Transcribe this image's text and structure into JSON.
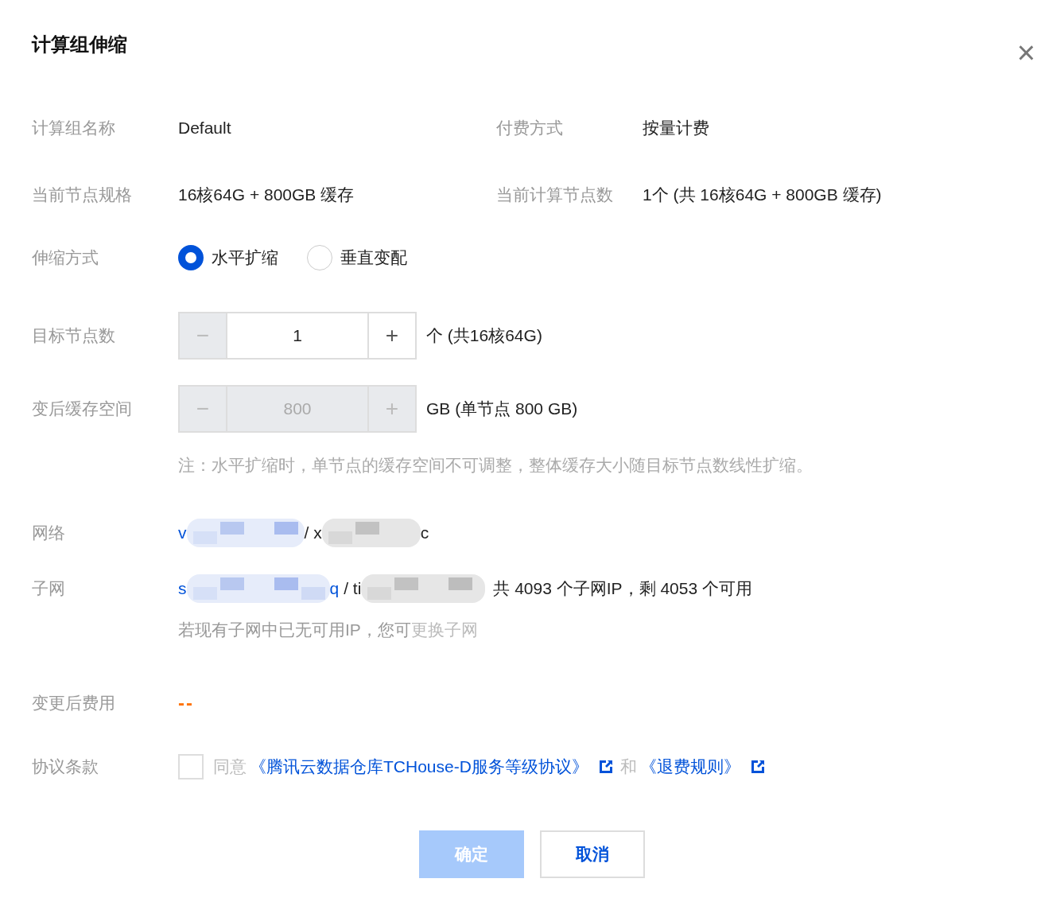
{
  "dialog": {
    "title": "计算组伸缩",
    "close": "×"
  },
  "info": [
    {
      "label": "计算组名称",
      "value": "Default",
      "label2": "付费方式",
      "value2": "按量计费"
    },
    {
      "label": "当前节点规格",
      "value": "16核64G + 800GB 缓存",
      "label2": "当前计算节点数",
      "value2": "1个 (共 16核64G + 800GB 缓存)"
    }
  ],
  "scale_mode": {
    "label": "伸缩方式",
    "options": [
      {
        "label": "水平扩缩",
        "selected": true
      },
      {
        "label": "垂直变配",
        "selected": false
      }
    ]
  },
  "steppers": [
    {
      "label": "目标节点数",
      "minus": "−",
      "value": "1",
      "plus": "+",
      "disabled": false,
      "suffix": "个 (共16核64G)"
    },
    {
      "label": "变后缓存空间",
      "minus": "−",
      "value": "800",
      "plus": "+",
      "disabled": true,
      "suffix": "GB (单节点 800 GB)"
    }
  ],
  "note": "注：水平扩缩时，单节点的缓存空间不可调整，整体缓存大小随目标节点数线性扩缩。",
  "network": {
    "label": "网络",
    "parts": [
      "v",
      "/ x",
      "c"
    ]
  },
  "subnet": {
    "label": "子网",
    "parts": [
      "s",
      "q",
      "/ ti"
    ],
    "summary": "共 4093 个子网IP，剩 4053 个可用",
    "hint": "若现有子网中已无可用IP，您可",
    "hint_link": "更换子网"
  },
  "cost": {
    "label": "变更后费用",
    "value": "--"
  },
  "agreement": {
    "label": "协议条款",
    "checked": false,
    "agree": "同意",
    "link1": "《腾讯云数据仓库TCHouse-D服务等级协议》",
    "and": "和",
    "link2": "《退费规则》"
  },
  "buttons": [
    {
      "label": "确定",
      "kind": "primary",
      "disabled": true
    },
    {
      "label": "取消",
      "kind": "default"
    }
  ]
}
